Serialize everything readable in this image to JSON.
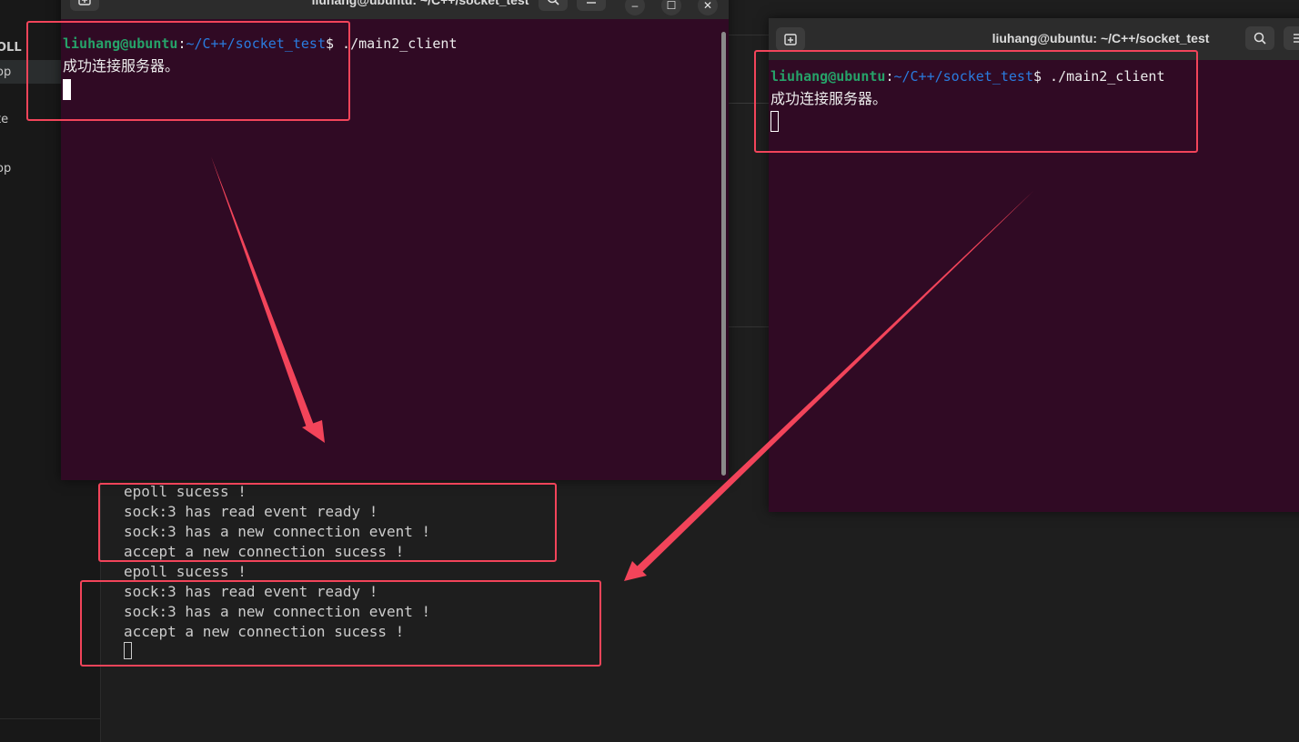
{
  "background": {
    "sidebar_fragments": [
      "OLL",
      "op",
      "te",
      "op"
    ]
  },
  "window1": {
    "title": "liuhang@ubuntu: ~/C++/socket_test",
    "prompt_user": "liuhang@ubuntu",
    "prompt_sep": ":",
    "prompt_path": "~/C++/socket_test",
    "prompt_dollar": "$",
    "command": " ./main2_client",
    "output": "成功连接服务器。",
    "buttons": {
      "minimize": "–",
      "maximize": "☐",
      "close": "✕"
    }
  },
  "window2": {
    "title": "liuhang@ubuntu: ~/C++/socket_test",
    "prompt_user": "liuhang@ubuntu",
    "prompt_sep": ":",
    "prompt_path": "~/C++/socket_test",
    "prompt_dollar": "$",
    "command": " ./main2_client",
    "output": "成功连接服务器。"
  },
  "server_output": [
    "epoll sucess !",
    "sock:3 has read event ready !",
    "sock:3 has a new connection event !",
    "accept a new connection sucess !",
    "epoll sucess !",
    "sock:3 has read event ready !",
    "sock:3 has a new connection event !",
    "accept a new connection sucess !"
  ],
  "colors": {
    "terminal_bg": "#300a24",
    "prompt_user": "#26a269",
    "prompt_path": "#2a7bde",
    "annotation": "#f2445a"
  }
}
